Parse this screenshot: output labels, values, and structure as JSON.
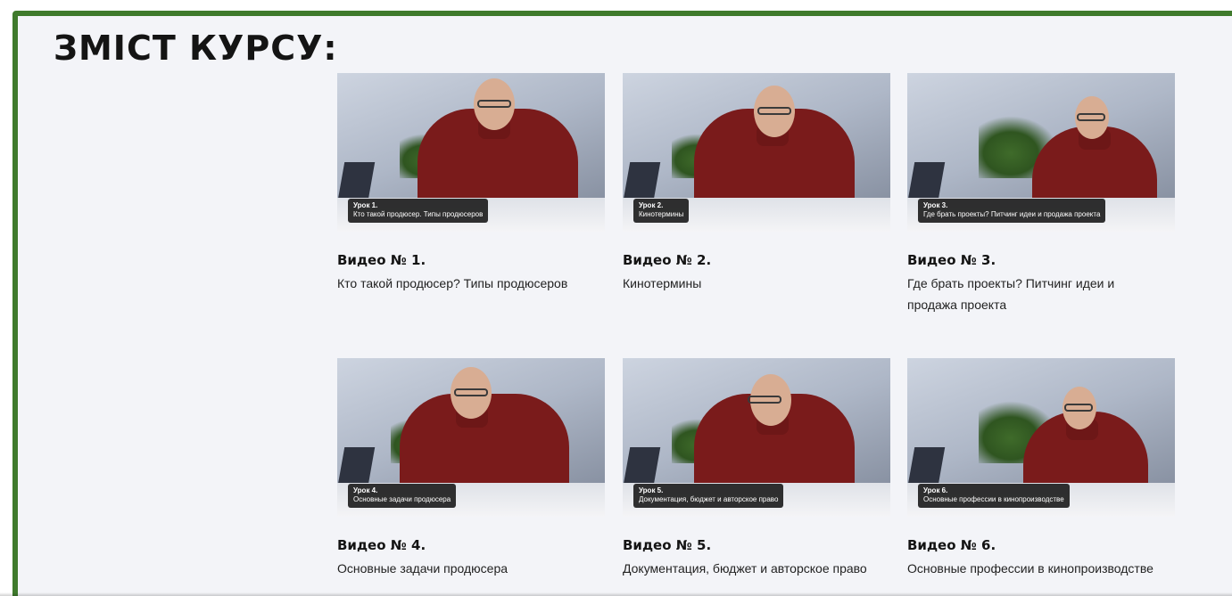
{
  "section": {
    "title": "ЗМІСТ КУРСУ:"
  },
  "videos": [
    {
      "title": "Видео № 1.",
      "description": "Кто такой продюсер? Типы продюсеров",
      "badge_lesson": "Урок 1.",
      "badge_text": "Кто такой продюсер. Типы продюсеров"
    },
    {
      "title": "Видео № 2.",
      "description": "Кинотермины",
      "badge_lesson": "Урок 2.",
      "badge_text": "Кинотермины"
    },
    {
      "title": "Видео № 3.",
      "description": "Где брать проекты? Питчинг идеи и продажа проекта",
      "badge_lesson": "Урок 3.",
      "badge_text": "Где брать проекты? Питчинг идеи и продажа проекта"
    },
    {
      "title": "Видео № 4.",
      "description": "Основные задачи продюсера",
      "badge_lesson": "Урок 4.",
      "badge_text": "Основные задачи продюсера"
    },
    {
      "title": "Видео № 5.",
      "description": "Документация, бюджет и авторское право",
      "badge_lesson": "Урок 5.",
      "badge_text": "Документация, бюджет и авторское право"
    },
    {
      "title": "Видео № 6.",
      "description": "Основные профессии в кинопроизводстве",
      "badge_lesson": "Урок 6.",
      "badge_text": "Основные профессии в кинопроизводстве"
    }
  ],
  "colors": {
    "frame_border": "#3f7a2c",
    "background": "#f3f4f8",
    "badge_bg": "#141414",
    "sweater": "#7a1b1b"
  }
}
